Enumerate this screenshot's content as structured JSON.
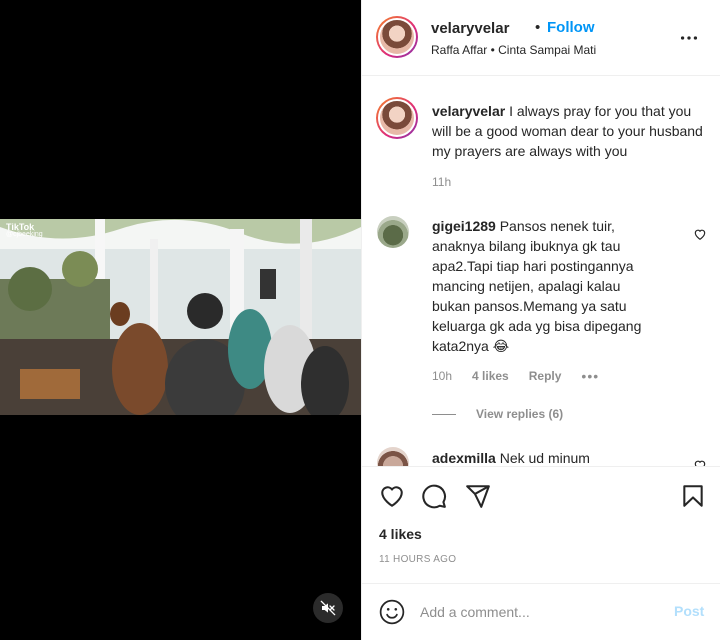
{
  "post": {
    "username": "velaryvelar",
    "follow_label": "Follow",
    "separator": "•",
    "subtitle": "Raffa Affar • Cinta Sampai Mati",
    "video_watermark_top": "TikTok",
    "video_watermark_bottom": "@cjbeeking"
  },
  "caption": {
    "username": "velaryvelar",
    "text": "I always pray for you that you will be a good woman dear to your husband my prayers are always with you",
    "time": "11h"
  },
  "comments": [
    {
      "username": "gigei1289",
      "text": "Pansos nenek tuir, anaknya bilang ibuknya gk tau apa2.Tapi tiap hari postingannya mancing netijen, apalagi kalau bukan pansos.Memang ya satu keluarga gk ada yg bisa dipegang kata2nya 😂",
      "time": "10h",
      "likes": "4 likes",
      "reply_label": "Reply",
      "view_replies": "View replies (6)"
    },
    {
      "username": "adexmilla",
      "text": "Nek ud minum"
    }
  ],
  "footer": {
    "likes": "4 likes",
    "time_ago": "11 HOURS AGO",
    "comment_placeholder": "Add a comment...",
    "post_label": "Post"
  },
  "colors": {
    "accent": "#0095f6",
    "post_disabled": "#b2dffc",
    "muted": "#8e8e8e"
  }
}
